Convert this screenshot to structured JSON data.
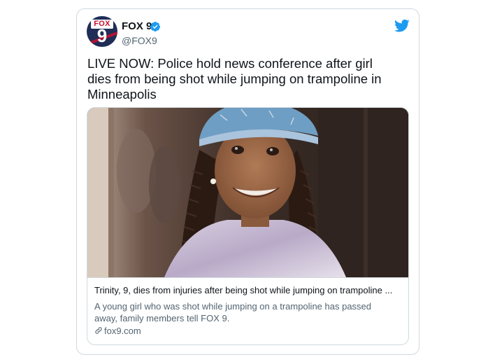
{
  "account": {
    "display_name": "FOX 9",
    "handle": "@FOX9",
    "avatar_brand": "FOX",
    "avatar_number": "9",
    "verified": true
  },
  "tweet": {
    "text": "LIVE NOW: Police hold news conference after girl dies from being shot while jumping on trampoline in Minneapolis"
  },
  "card": {
    "title": "Trinity, 9, dies from injuries after being shot while jumping on trampoline ...",
    "description": "A young girl who was shot while jumping on a trampoline has passed away, family members tell FOX 9.",
    "domain": "fox9.com"
  },
  "icons": {
    "verified": "verified-badge-icon",
    "twitter": "twitter-bird-icon",
    "link": "link-icon"
  },
  "colors": {
    "twitter_blue": "#1d9bf0",
    "text_primary": "#0f1419",
    "text_secondary": "#536471",
    "border": "#cfd9de",
    "fox_red": "#c8102e",
    "fox_navy": "#1f2d57"
  }
}
